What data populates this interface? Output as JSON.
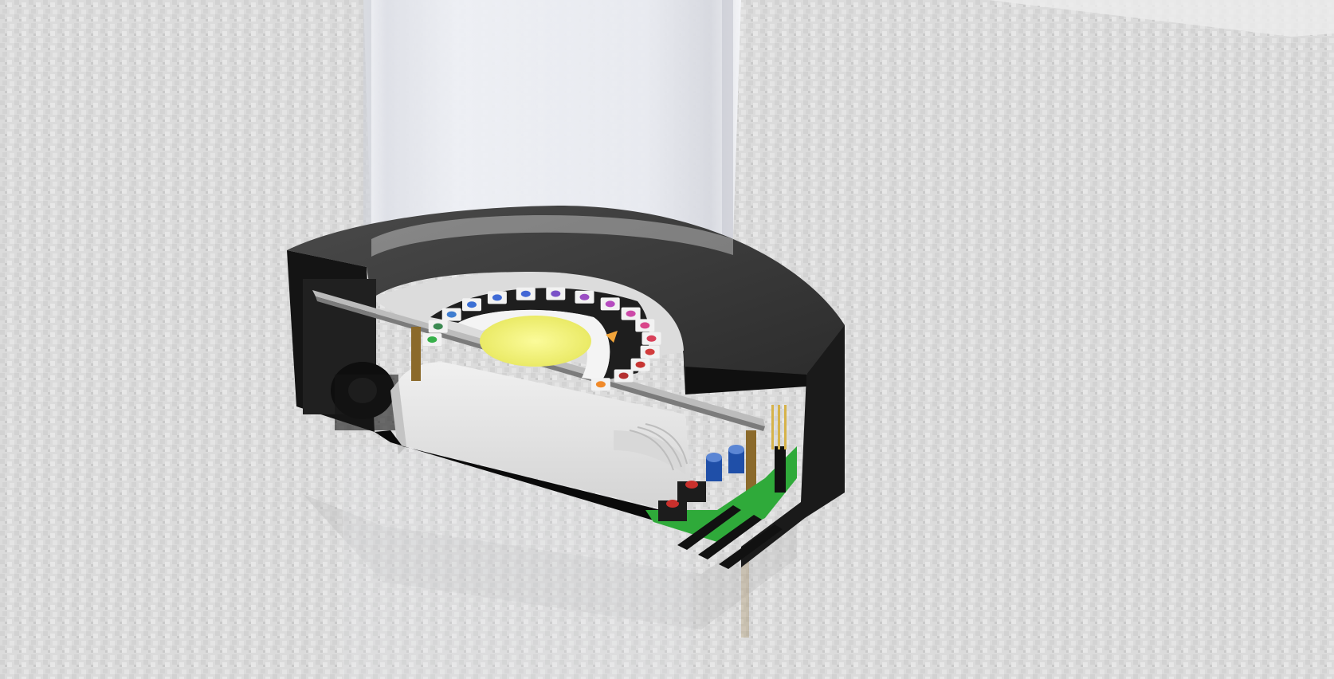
{
  "scene": {
    "description_visible_text": "",
    "colors": {
      "floor": "#d6d6d6",
      "floor_dark": "#bdbdbd",
      "housing": "#1b1b1b",
      "housing_top": "#3a3a3a",
      "tube_glass": "#eceef4",
      "cob_led": "#f2f27e",
      "pcb_green": "#2faa3a",
      "driver_box": "#e6e6e6",
      "capacitor_blue": "#1f4fa8",
      "button_red": "#c9302c",
      "brass_pillar": "#8b6a2b"
    },
    "rgb_ring_led_colors": [
      "#37b04a",
      "#3c8a52",
      "#3f7dd0",
      "#3b6fd4",
      "#3f6ad6",
      "#4468d5",
      "#7a52c8",
      "#9b4fc4",
      "#b64cc0",
      "#cc4aa8",
      "#d9468a",
      "#d8415a",
      "#d23c3c",
      "#c73533",
      "#b43030",
      "#f08a2a"
    ]
  }
}
